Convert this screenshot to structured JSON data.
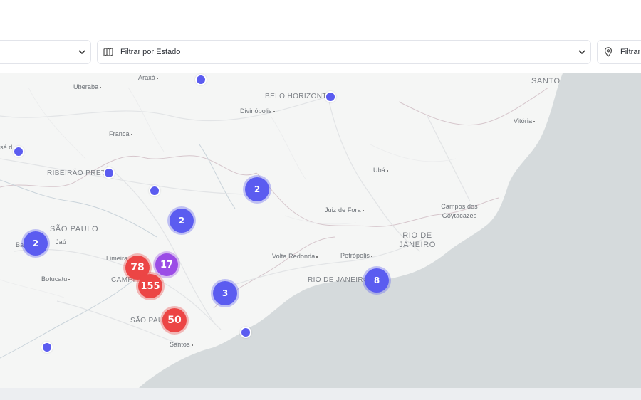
{
  "filters": {
    "state_label": "Filtrar por Estado",
    "right_label": "Filtrar"
  },
  "map": {
    "places": {
      "araxa": "Araxá",
      "uberaba": "Uberaba",
      "belo_horizonte": "BELO HORIZONT",
      "divinopolis": "Divinópolis",
      "santo": "SANTO",
      "vitoria": "Vitória",
      "franca": "Franca",
      "se_d": "sé d",
      "ribeirao_preto": "RIBEIRÃO PRET",
      "uba": "Ubá",
      "juiz_de_fora": "Juiz de Fora",
      "campos": "Campos dos\nGoytacazes",
      "sao_paulo_state": "SÃO PAULO",
      "jau": "Jaú",
      "ba": "Ba",
      "rio_de_janeiro_state": "RIO DE\nJANEIRO",
      "limeira": "Limeira",
      "volta_redonda": "Volta Redonda",
      "petropolis": "Petrópolis",
      "botucatu": "Botucatu",
      "campinas": "CAMPI",
      "rio_de_janeiro_city": "RIO DE JANEIRO",
      "sao_paulo_city": "SÃO PAU",
      "santos": "Santos"
    },
    "clusters": [
      {
        "count": "2",
        "color": "#5b5cf0"
      },
      {
        "count": "2",
        "color": "#5b5cf0"
      },
      {
        "count": "2",
        "color": "#5b5cf0"
      },
      {
        "count": "78",
        "color": "#ec4545"
      },
      {
        "count": "17",
        "color": "#9b4ce6"
      },
      {
        "count": "155",
        "color": "#ec4545"
      },
      {
        "count": "3",
        "color": "#5b5cf0"
      },
      {
        "count": "8",
        "color": "#5b5cf0"
      },
      {
        "count": "50",
        "color": "#ec4545"
      }
    ],
    "pin_color": "#5b5cf0",
    "ocean_color": "#d5dadc",
    "land_color": "#f5f6f5"
  }
}
